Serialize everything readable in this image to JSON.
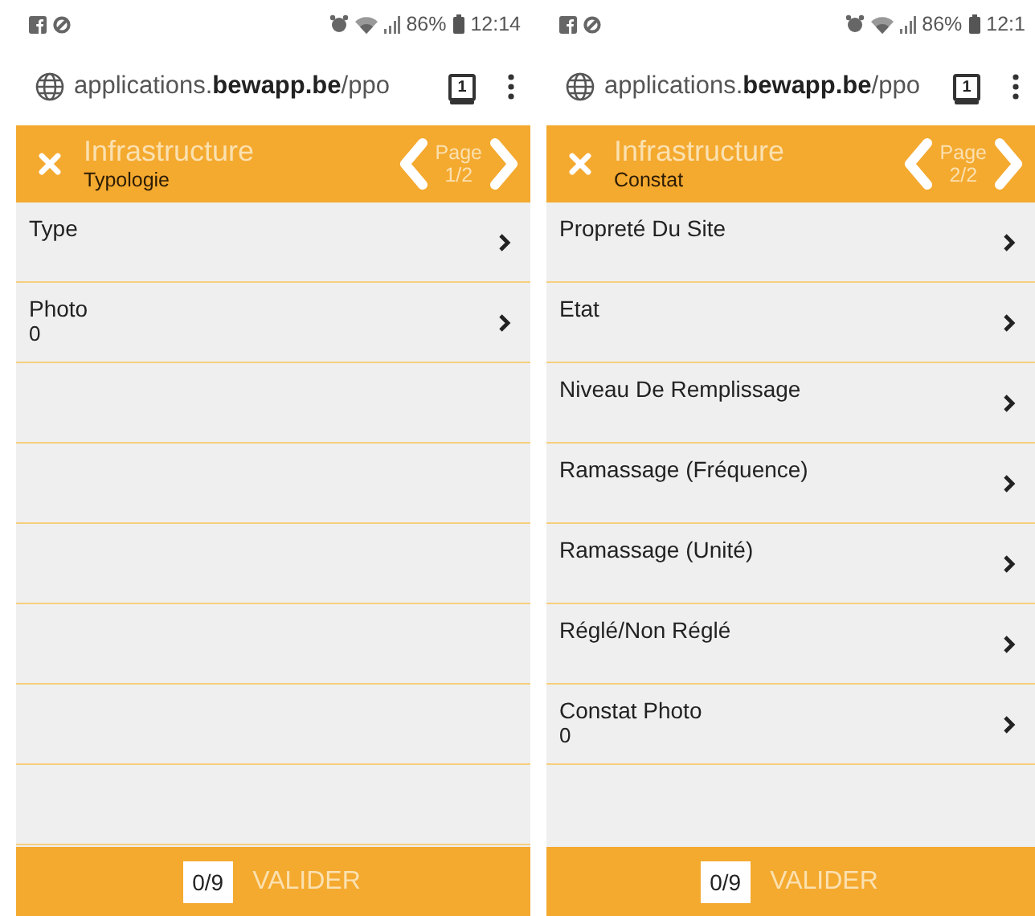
{
  "screens": [
    {
      "status": {
        "battery": "86%",
        "time": "12:14"
      },
      "address": {
        "url": "applications.**bewapp.be**/ppo",
        "tabs": "1"
      },
      "header": {
        "title": "Infrastructure",
        "subtitle": "Typologie",
        "page_label": "Page",
        "page_number": "1/2"
      },
      "rows": [
        {
          "kind": "field",
          "label": "Type"
        },
        {
          "kind": "field",
          "label": "Photo",
          "value": "0"
        },
        {
          "kind": "blank"
        },
        {
          "kind": "blank"
        },
        {
          "kind": "blank"
        },
        {
          "kind": "blank"
        },
        {
          "kind": "blank"
        },
        {
          "kind": "blank"
        }
      ],
      "footer": {
        "count": "0/9",
        "button": "VALIDER"
      }
    },
    {
      "status": {
        "battery": "86%",
        "time": "12:1"
      },
      "address": {
        "url": "applications.**bewapp.be**/ppo",
        "tabs": "1"
      },
      "header": {
        "title": "Infrastructure",
        "subtitle": "Constat",
        "page_label": "Page",
        "page_number": "2/2"
      },
      "rows": [
        {
          "kind": "field",
          "label": "Propreté Du Site"
        },
        {
          "kind": "field",
          "label": "Etat"
        },
        {
          "kind": "field",
          "label": "Niveau De Remplissage"
        },
        {
          "kind": "field",
          "label": "Ramassage (Fréquence)"
        },
        {
          "kind": "field",
          "label": "Ramassage (Unité)"
        },
        {
          "kind": "field",
          "label": "Réglé/Non Réglé"
        },
        {
          "kind": "field",
          "label": "Constat Photo",
          "value": "0"
        }
      ],
      "footer": {
        "count": "0/9",
        "button": "VALIDER"
      }
    }
  ]
}
